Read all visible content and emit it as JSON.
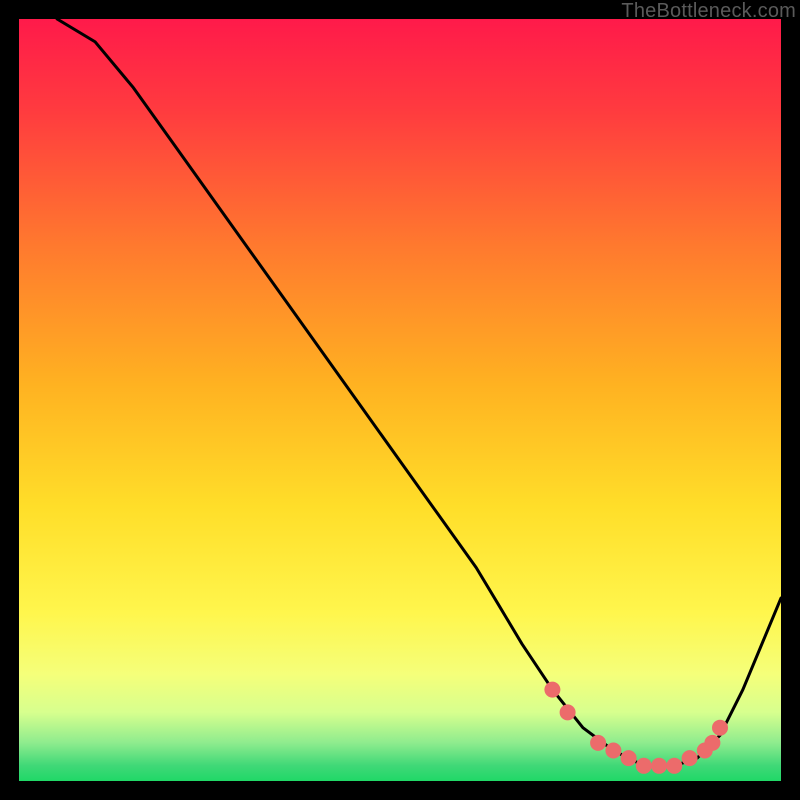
{
  "attribution": "TheBottleneck.com",
  "colors": {
    "top": "#ff1a4a",
    "mid": "#ffde29",
    "green": "#20d867",
    "curve": "#000000",
    "markers": "#ec6b6b"
  },
  "chart_data": {
    "type": "line",
    "title": "",
    "xlabel": "",
    "ylabel": "",
    "xlim": [
      0,
      100
    ],
    "ylim": [
      0,
      100
    ],
    "grid": false,
    "legend": false,
    "series": [
      {
        "name": "bottleneck-curve",
        "x": [
          5,
          10,
          15,
          20,
          25,
          30,
          35,
          40,
          45,
          50,
          55,
          60,
          63,
          66,
          70,
          74,
          78,
          82,
          86,
          89,
          92,
          95,
          100
        ],
        "values": [
          100,
          97,
          91,
          84,
          77,
          70,
          63,
          56,
          49,
          42,
          35,
          28,
          23,
          18,
          12,
          7,
          4,
          2,
          2,
          3,
          6,
          12,
          24
        ]
      }
    ],
    "markers": {
      "name": "highlight-points",
      "x": [
        70,
        72,
        76,
        78,
        80,
        82,
        84,
        86,
        88,
        90,
        91,
        92
      ],
      "values": [
        12,
        9,
        5,
        4,
        3,
        2,
        2,
        2,
        3,
        4,
        5,
        7
      ]
    },
    "description": "A V-shaped black curve over a vertical red→yellow→green gradient. The curve descends steeply from the upper-left, reaches a minimum around x≈82–86 near the bottom green band, and rises again toward the right edge. Salmon-colored dots mark the flat bottom region of the curve."
  }
}
